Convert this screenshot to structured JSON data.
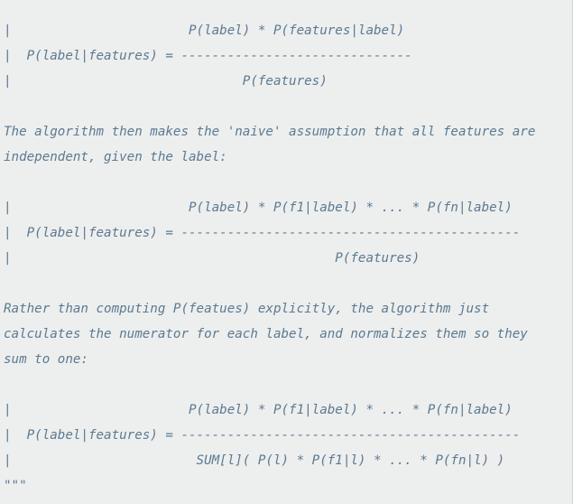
{
  "docstring": {
    "lines": [
      "|                       P(label) * P(features|label)",
      "|  P(label|features) = ------------------------------",
      "|                              P(features)",
      "",
      "The algorithm then makes the 'naive' assumption that all features are",
      "independent, given the label:",
      "",
      "|                       P(label) * P(f1|label) * ... * P(fn|label)",
      "|  P(label|features) = --------------------------------------------",
      "|                                          P(features)",
      "",
      "Rather than computing P(featues) explicitly, the algorithm just",
      "calculates the numerator for each label, and normalizes them so they",
      "sum to one:",
      "",
      "|                       P(label) * P(f1|label) * ... * P(fn|label)",
      "|  P(label|features) = --------------------------------------------",
      "|                        SUM[l]( P(l) * P(f1|l) * ... * P(fn|l) )",
      "\"\"\""
    ]
  },
  "colors": {
    "background": "#edeeee",
    "docstring_text": "#5b7a91"
  }
}
